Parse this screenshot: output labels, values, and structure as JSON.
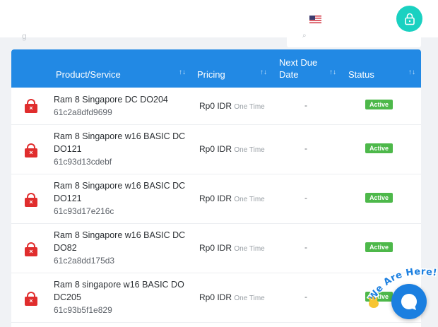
{
  "header": {
    "flag_icon": "us-flag-icon",
    "user_icon": "lock-user-icon",
    "accent_color": "#1ad1c1"
  },
  "subbar": {
    "partial_label": "g"
  },
  "table": {
    "header_color": "#2289e4",
    "columns": [
      "Product/Service",
      "Pricing",
      "Next Due",
      "Date",
      "Status"
    ],
    "rows": [
      {
        "name": "Ram 8 Singapore DC DO204",
        "id": "61c2a8dfd9699",
        "price": "Rp0 IDR",
        "cycle": "One Time",
        "due": "-",
        "status": "Active"
      },
      {
        "name": "Ram 8 Singapore w16 BASIC DC DO121",
        "id": "61c93d13cdebf",
        "price": "Rp0 IDR",
        "cycle": "One Time",
        "due": "-",
        "status": "Active"
      },
      {
        "name": "Ram 8 Singapore w16 BASIC DC DO121",
        "id": "61c93d17e216c",
        "price": "Rp0 IDR",
        "cycle": "One Time",
        "due": "-",
        "status": "Active"
      },
      {
        "name": "Ram 8 Singapore w16 BASIC DC DO82",
        "id": "61c2a8dd175d3",
        "price": "Rp0 IDR",
        "cycle": "One Time",
        "due": "-",
        "status": "Active"
      },
      {
        "name": "Ram 8 singapore w16 BASIC DO DC205",
        "id": "61c93b5f1e829",
        "price": "Rp0 IDR",
        "cycle": "One Time",
        "due": "-",
        "status": "Active"
      }
    ],
    "status_color": "#4db84a"
  },
  "chat": {
    "tagline": "We Are Here!",
    "button_color": "#1b7fe0"
  }
}
